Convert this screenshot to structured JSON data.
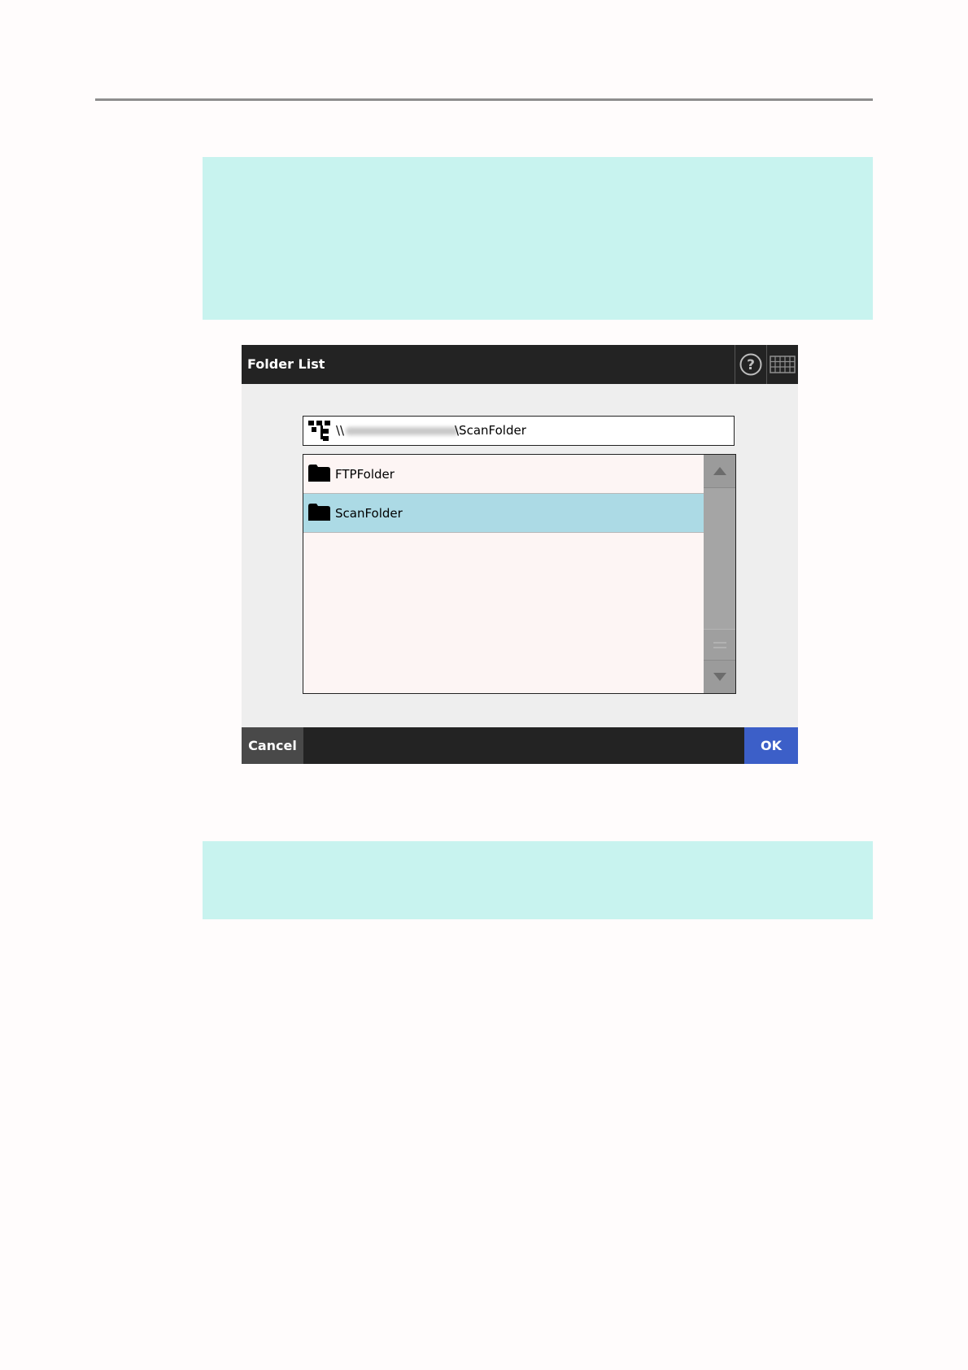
{
  "dialog": {
    "title": "Folder List",
    "help_icon": "help-question-icon",
    "keyboard_icon": "keyboard-icon",
    "path": {
      "icon": "network-tree-icon",
      "prefix": "\\\\",
      "suffix": "\\ScanFolder"
    },
    "folders": [
      {
        "label": "FTPFolder",
        "icon": "folder-icon",
        "selected": false
      },
      {
        "label": "ScanFolder",
        "icon": "folder-icon",
        "selected": true
      }
    ],
    "cancel_label": "Cancel",
    "ok_label": "OK"
  },
  "colors": {
    "note_background": "#c8f3ef",
    "titlebar": "#232323",
    "selected_row": "#acdae5",
    "ok_button": "#3c5fc8"
  }
}
